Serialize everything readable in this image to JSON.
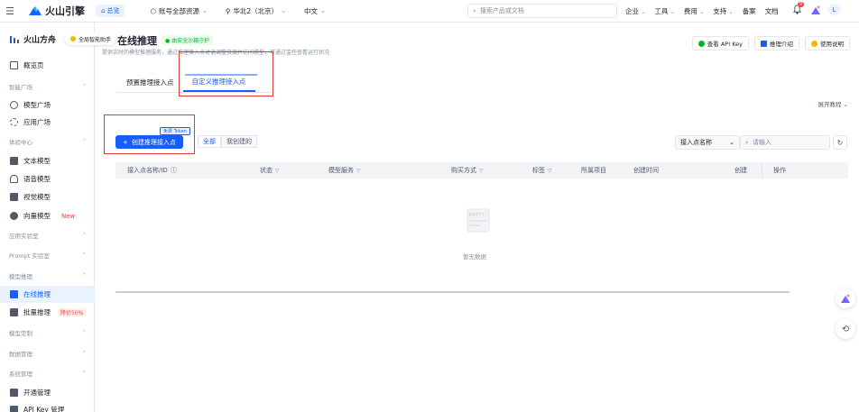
{
  "topbar": {
    "brand": "火山引擎",
    "home": "总览",
    "account": "账号全部资源",
    "region": "华北2（北京）",
    "language": "中文",
    "search_placeholder": "搜索产品或文档",
    "menu": [
      "企业",
      "工具",
      "费用",
      "支持",
      "备案",
      "文档"
    ],
    "notifications": "9",
    "avatar": "L"
  },
  "sidebar": {
    "brand": "火山方舟",
    "assistant": "全局智能助手",
    "items": {
      "overview": "概览页",
      "group_plaza": "智能广场",
      "model_plaza": "模型广场",
      "app_plaza": "应用广场",
      "group_experience": "体验中心",
      "text_model": "文本模型",
      "voice_model": "语音模型",
      "vision_model": "视觉模型",
      "vector_model": "向量模型",
      "vector_new": "New",
      "group_lab": "应用实验室",
      "group_prompt": "Prompt 实验室",
      "group_inference": "模型推理",
      "online_inference": "在线推理",
      "batch_inference": "批量推理",
      "batch_discount": "降价50%",
      "group_custom": "模型定制",
      "group_data": "数据管理",
      "group_system": "系统管理",
      "activation": "开通管理",
      "api_key": "API Key 管理"
    }
  },
  "main": {
    "title": "在线推理",
    "security": "由安全沙箱守护",
    "desc": "提供实时的模型推理服务，通过推理接入点对话调整资源并访问模型，可通过监控查看运行状况",
    "head_buttons": [
      "查看 API Key",
      "推理介绍",
      "使用说明"
    ],
    "tabs": [
      "预置推理接入点",
      "自定义推理接入点"
    ],
    "expand": "展开教程",
    "create_button": "创建推理接入点",
    "free_badge": "免费 Token",
    "filter_tabs": [
      "全部",
      "我创建的"
    ],
    "select_label": "接入点名称",
    "search_placeholder": "请输入",
    "columns": [
      "接入点名称/ID",
      "状态",
      "模型服务",
      "购买方式",
      "标签",
      "所属项目",
      "创建时间",
      "创建",
      "操作"
    ],
    "empty_label": "EMPTY",
    "empty_text": "暂无数据"
  },
  "colors": {
    "primary": "#165dff",
    "highlight": "#e53935",
    "success": "#00b42a"
  }
}
